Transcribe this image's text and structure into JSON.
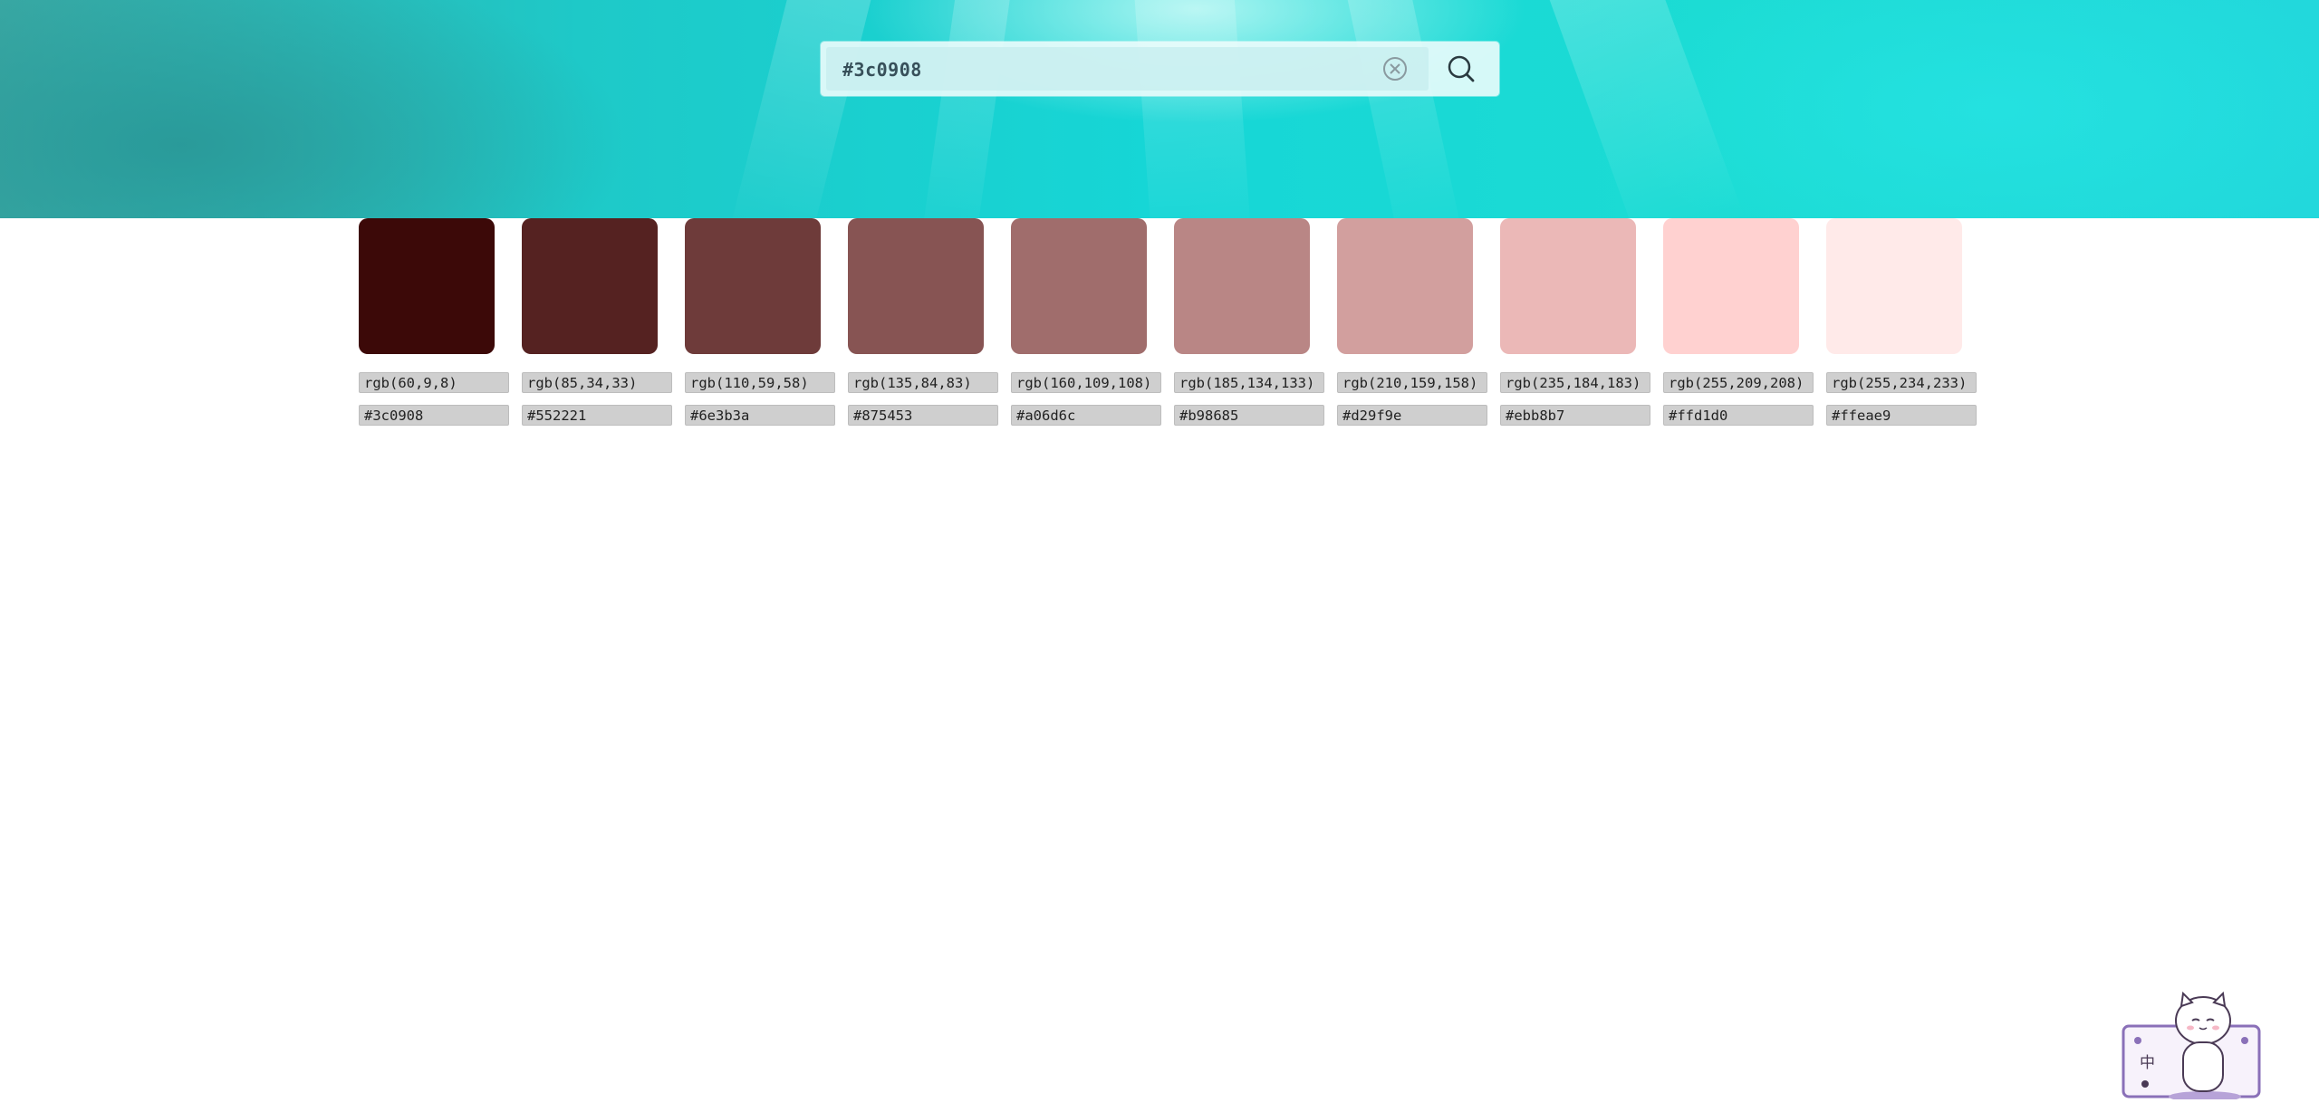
{
  "search": {
    "value": "#3c0908",
    "clear_icon": "circle-x-icon",
    "search_icon": "magnifier-icon"
  },
  "palette": [
    {
      "rgb": "rgb(60,9,8)",
      "hex": "#3c0908",
      "color": "#3c0908"
    },
    {
      "rgb": "rgb(85,34,33)",
      "hex": "#552221",
      "color": "#552221"
    },
    {
      "rgb": "rgb(110,59,58)",
      "hex": "#6e3b3a",
      "color": "#6e3b3a"
    },
    {
      "rgb": "rgb(135,84,83)",
      "hex": "#875453",
      "color": "#875453"
    },
    {
      "rgb": "rgb(160,109,108)",
      "hex": "#a06d6c",
      "color": "#a06d6c"
    },
    {
      "rgb": "rgb(185,134,133)",
      "hex": "#b98685",
      "color": "#b98685"
    },
    {
      "rgb": "rgb(210,159,158)",
      "hex": "#d29f9e",
      "color": "#d29f9e"
    },
    {
      "rgb": "rgb(235,184,183)",
      "hex": "#ebb8b7",
      "color": "#ebb8b7"
    },
    {
      "rgb": "rgb(255,209,208)",
      "hex": "#ffd1d0",
      "color": "#ffd1d0"
    },
    {
      "rgb": "rgb(255,234,233)",
      "hex": "#ffeae9",
      "color": "#ffeae9"
    }
  ],
  "mascot": {
    "badge_text": "中",
    "icon": "cat-mascot-icon"
  },
  "colors": {
    "hero_teal": "#16d6d6",
    "code_bg": "#cfcfcf"
  }
}
